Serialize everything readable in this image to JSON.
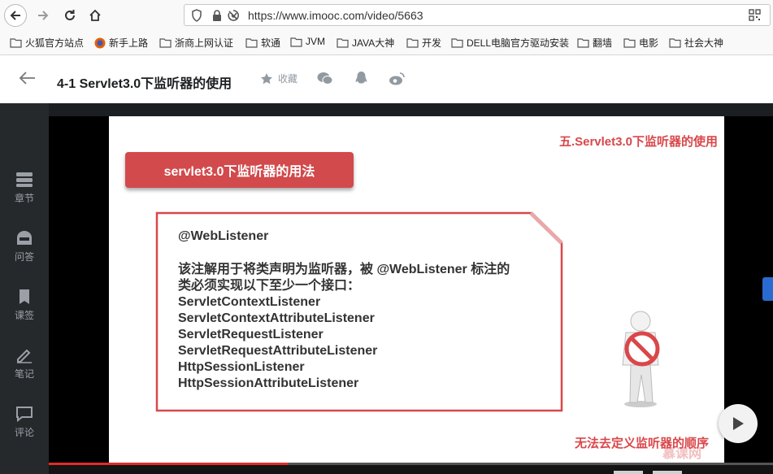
{
  "browser": {
    "url": "https://www.imooc.com/video/5663",
    "bookmarks": [
      "火狐官方站点",
      "新手上路",
      "浙商上网认证",
      "软通",
      "JVM",
      "JAVA大神",
      "开发",
      "DELL电脑官方驱动安装",
      "翻墙",
      "电影",
      "社会大神"
    ]
  },
  "header": {
    "title": "4-1 Servlet3.0下监听器的使用",
    "favorite_label": "收藏"
  },
  "sidebar": {
    "items": [
      {
        "label": "章节",
        "icon": "chapter-icon"
      },
      {
        "label": "问答",
        "icon": "qa-icon"
      },
      {
        "label": "课签",
        "icon": "bookmark-icon"
      },
      {
        "label": "笔记",
        "icon": "note-icon"
      },
      {
        "label": "评论",
        "icon": "comment-icon"
      }
    ]
  },
  "slide": {
    "heading": "五.Servlet3.0下监听器的使用",
    "tag": "servlet3.0下监听器的用法",
    "annotation": "@WebListener",
    "description_1": "该注解用于将类声明为监听器，被 @WebListener 标注的",
    "description_2": "类必须实现以下至少一个接口：",
    "interfaces": [
      "ServletContextListener",
      "ServletContextAttributeListener",
      "ServletRequestListener",
      "ServletRequestAttributeListener",
      "HttpSessionListener",
      "HttpSessionAttributeListener"
    ],
    "footer": "无法去定义监听器的顺序",
    "watermark": "慕课网"
  },
  "player": {
    "progress": 0.33
  },
  "colors": {
    "accent": "#d9474a",
    "tag_bg": "#d24a4c",
    "progress": "#e02b2b",
    "rail_bg": "#26292c"
  }
}
